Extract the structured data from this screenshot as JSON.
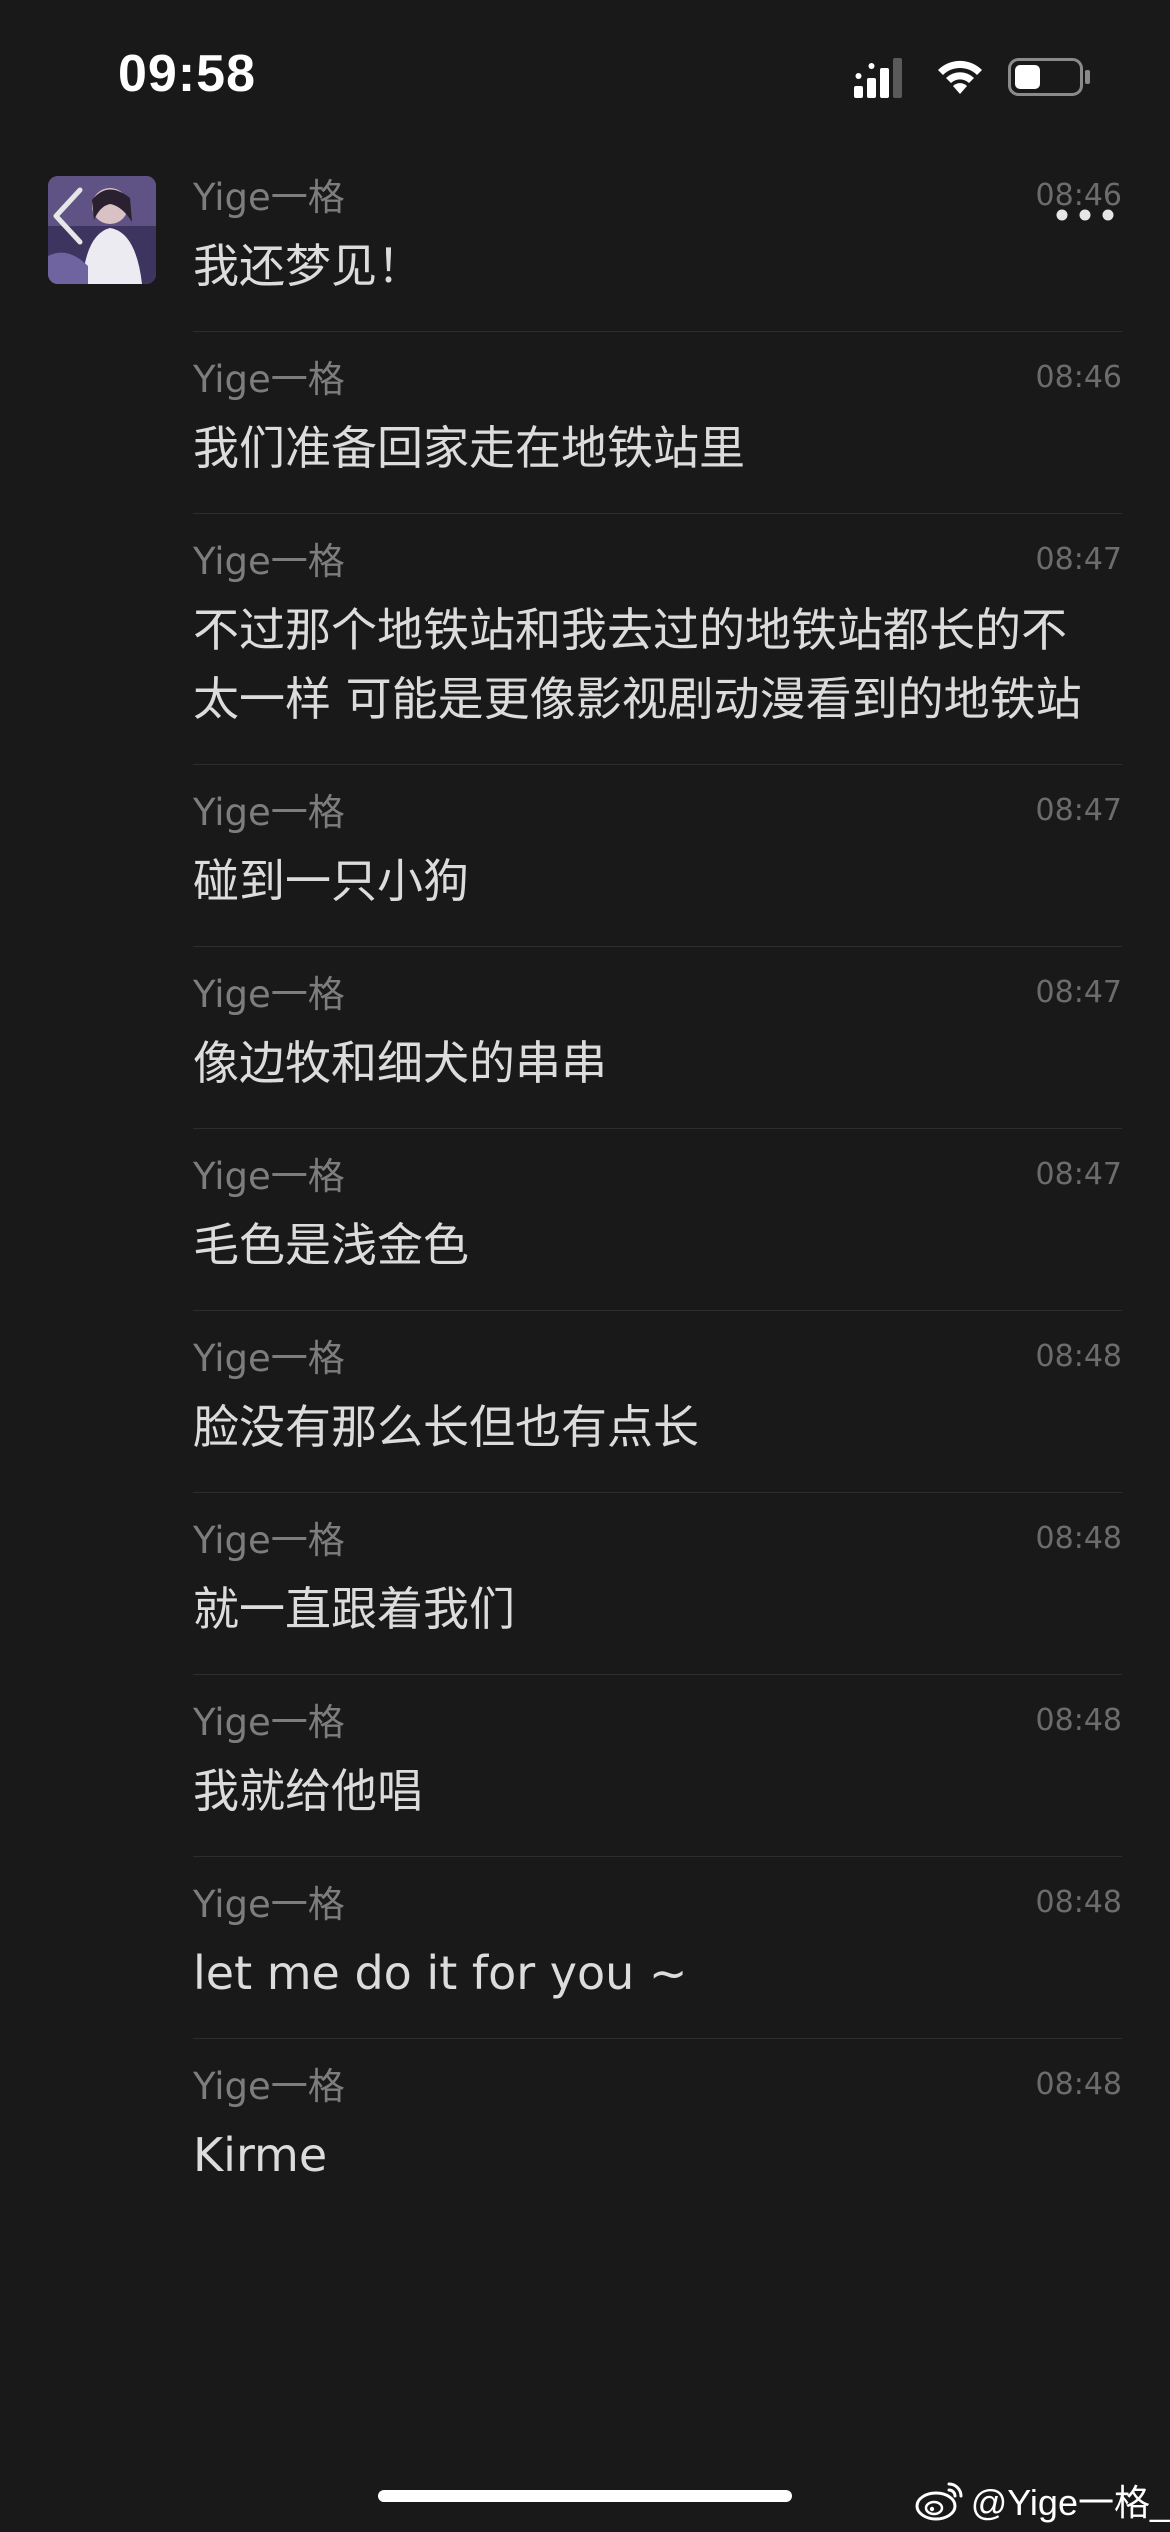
{
  "status_bar": {
    "time": "09:58",
    "signal_icon": "cellular-signal-icon",
    "wifi_icon": "wifi-icon",
    "battery_icon": "battery-icon",
    "battery_level": 0.4
  },
  "header": {
    "back_icon": "chevron-left-icon",
    "more_icon": "more-horizontal-icon"
  },
  "messages": [
    {
      "sender": "Yige一格",
      "time": "08:46",
      "text": "我还梦见！"
    },
    {
      "sender": "Yige一格",
      "time": "08:46",
      "text": "我们准备回家走在地铁站里"
    },
    {
      "sender": "Yige一格",
      "time": "08:47",
      "text": "不过那个地铁站和我去过的地铁站都长的不太一样 可能是更像影视剧动漫看到的地铁站"
    },
    {
      "sender": "Yige一格",
      "time": "08:47",
      "text": "碰到一只小狗"
    },
    {
      "sender": "Yige一格",
      "time": "08:47",
      "text": "像边牧和细犬的串串"
    },
    {
      "sender": "Yige一格",
      "time": "08:47",
      "text": "毛色是浅金色"
    },
    {
      "sender": "Yige一格",
      "time": "08:48",
      "text": "脸没有那么长但也有点长"
    },
    {
      "sender": "Yige一格",
      "time": "08:48",
      "text": "就一直跟着我们"
    },
    {
      "sender": "Yige一格",
      "time": "08:48",
      "text": "我就给他唱"
    },
    {
      "sender": "Yige一格",
      "time": "08:48",
      "text": "let me do it for you ~"
    },
    {
      "sender": "Yige一格",
      "time": "08:48",
      "text": "Kirme"
    }
  ],
  "watermark": {
    "icon": "weibo-icon",
    "text": "@Yige一格_"
  }
}
